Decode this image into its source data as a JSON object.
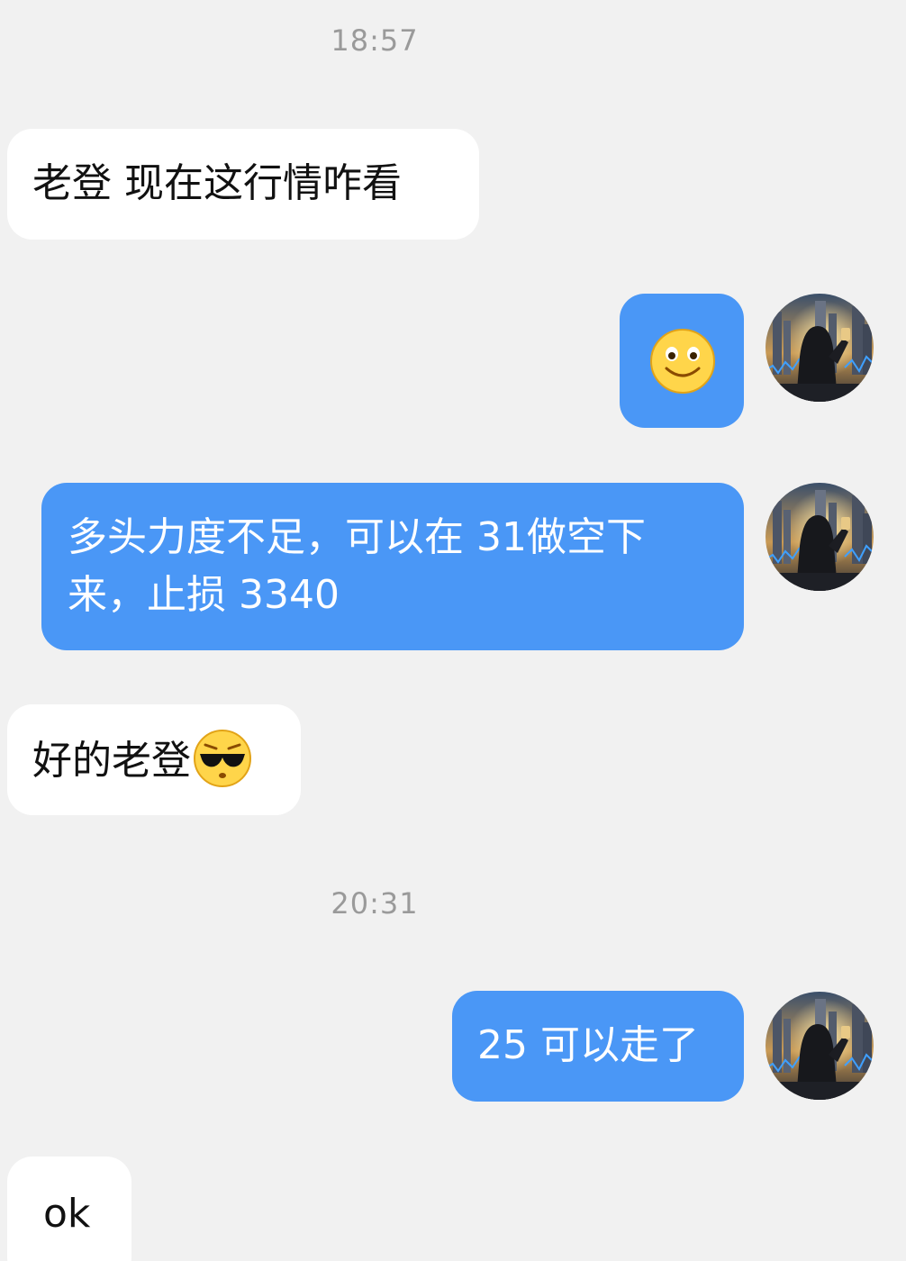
{
  "chat": {
    "timestamps": [
      "18:57",
      "20:31"
    ],
    "messages": [
      {
        "side": "in",
        "text": "老登 现在这行情咋看"
      },
      {
        "side": "out",
        "emoji": "smile-emoji"
      },
      {
        "side": "out",
        "text": "多头力度不足，可以在 31做空下来，止损 3340"
      },
      {
        "side": "in",
        "text": "好的老登",
        "emoji": "cool-sunglasses-emoji"
      },
      {
        "side": "out",
        "text": "25 可以走了"
      },
      {
        "side": "in",
        "text": "ok"
      }
    ]
  },
  "colors": {
    "background": "#f1f1f1",
    "incoming_bubble": "#ffffff",
    "outgoing_bubble": "#4a97f6",
    "timestamp_text": "#9a9a9a"
  }
}
